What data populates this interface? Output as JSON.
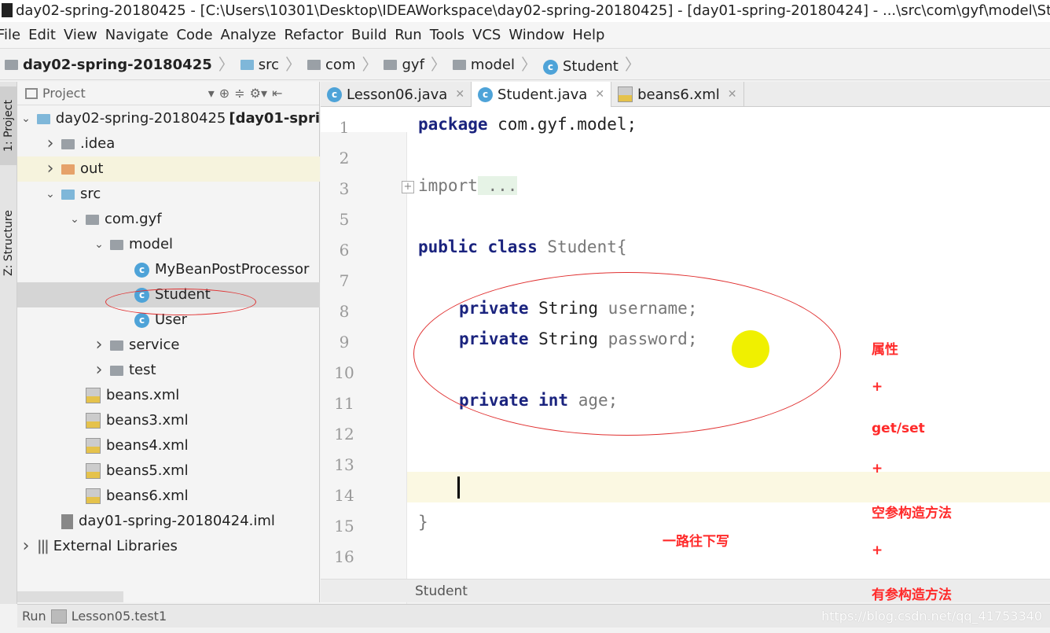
{
  "window": {
    "title": "day02-spring-20180425 - [C:\\Users\\10301\\Desktop\\IDEAWorkspace\\day02-spring-20180425] - [day01-spring-20180424] - ...\\src\\com\\gyf\\model\\Student.java"
  },
  "menu": [
    "File",
    "Edit",
    "View",
    "Navigate",
    "Code",
    "Analyze",
    "Refactor",
    "Build",
    "Run",
    "Tools",
    "VCS",
    "Window",
    "Help"
  ],
  "breadcrumb": [
    "day02-spring-20180425",
    "src",
    "com",
    "gyf",
    "model",
    "Student"
  ],
  "side_tabs": {
    "project": "1: Project",
    "structure": "Z: Structure"
  },
  "project": {
    "header": "Project",
    "tree": [
      {
        "label": "day02-spring-20180425",
        "suffix": "[day01-spri",
        "indent": 0,
        "arrow": "v",
        "icon": "module"
      },
      {
        "label": ".idea",
        "indent": 1,
        "arrow": ">",
        "icon": "folder"
      },
      {
        "label": "out",
        "indent": 1,
        "arrow": ">",
        "icon": "folder-orange"
      },
      {
        "label": "src",
        "indent": 1,
        "arrow": "v",
        "icon": "folder-blue"
      },
      {
        "label": "com.gyf",
        "indent": 2,
        "arrow": "v",
        "icon": "package"
      },
      {
        "label": "model",
        "indent": 3,
        "arrow": "v",
        "icon": "package"
      },
      {
        "label": "MyBeanPostProcessor",
        "indent": 4,
        "arrow": "",
        "icon": "class"
      },
      {
        "label": "Student",
        "indent": 4,
        "arrow": "",
        "icon": "class",
        "selected": true
      },
      {
        "label": "User",
        "indent": 4,
        "arrow": "",
        "icon": "class"
      },
      {
        "label": "service",
        "indent": 3,
        "arrow": ">",
        "icon": "package"
      },
      {
        "label": "test",
        "indent": 3,
        "arrow": ">",
        "icon": "package"
      },
      {
        "label": "beans.xml",
        "indent": 2,
        "arrow": "",
        "icon": "xml"
      },
      {
        "label": "beans3.xml",
        "indent": 2,
        "arrow": "",
        "icon": "xml"
      },
      {
        "label": "beans4.xml",
        "indent": 2,
        "arrow": "",
        "icon": "xml"
      },
      {
        "label": "beans5.xml",
        "indent": 2,
        "arrow": "",
        "icon": "xml"
      },
      {
        "label": "beans6.xml",
        "indent": 2,
        "arrow": "",
        "icon": "xml"
      },
      {
        "label": "day01-spring-20180424.iml",
        "indent": 1,
        "arrow": "",
        "icon": "iml"
      },
      {
        "label": "External Libraries",
        "indent": 0,
        "arrow": ">",
        "icon": "libraries"
      }
    ]
  },
  "tabs": [
    {
      "label": "Lesson06.java",
      "icon": "class"
    },
    {
      "label": "Student.java",
      "icon": "class",
      "active": true
    },
    {
      "label": "beans6.xml",
      "icon": "xml"
    }
  ],
  "code": {
    "line_numbers": [
      "1",
      "2",
      "3",
      "5",
      "6",
      "7",
      "8",
      "9",
      "10",
      "11",
      "12",
      "13",
      "14",
      "15",
      "16"
    ],
    "l1": {
      "kw": "package",
      "rest": " com.gyf.model;"
    },
    "l3": {
      "kw": "import",
      "rest": " ..."
    },
    "l6": {
      "kw": "public class",
      "rest": " Student{"
    },
    "l8": {
      "kw": "private",
      "type": " String",
      "rest": " username;"
    },
    "l9": {
      "kw": "private",
      "type": " String",
      "rest": " password;"
    },
    "l11": {
      "kw": "private int",
      "rest": " age;"
    },
    "l15": "}"
  },
  "annotations": {
    "notes": [
      "属性",
      "+",
      "get/set",
      "+",
      "空参构造方法",
      "+",
      "有参构造方法"
    ],
    "middle": "一路往下写"
  },
  "status": {
    "breadcrumb": "Student"
  },
  "run": {
    "label": "Run",
    "config": "Lesson05.test1"
  },
  "watermark": "https://blog.csdn.net/qq_41753340",
  "colors": {
    "annotation": "#ff2a2a",
    "keyword": "#1a237e",
    "current_line": "#fbf8e2"
  }
}
